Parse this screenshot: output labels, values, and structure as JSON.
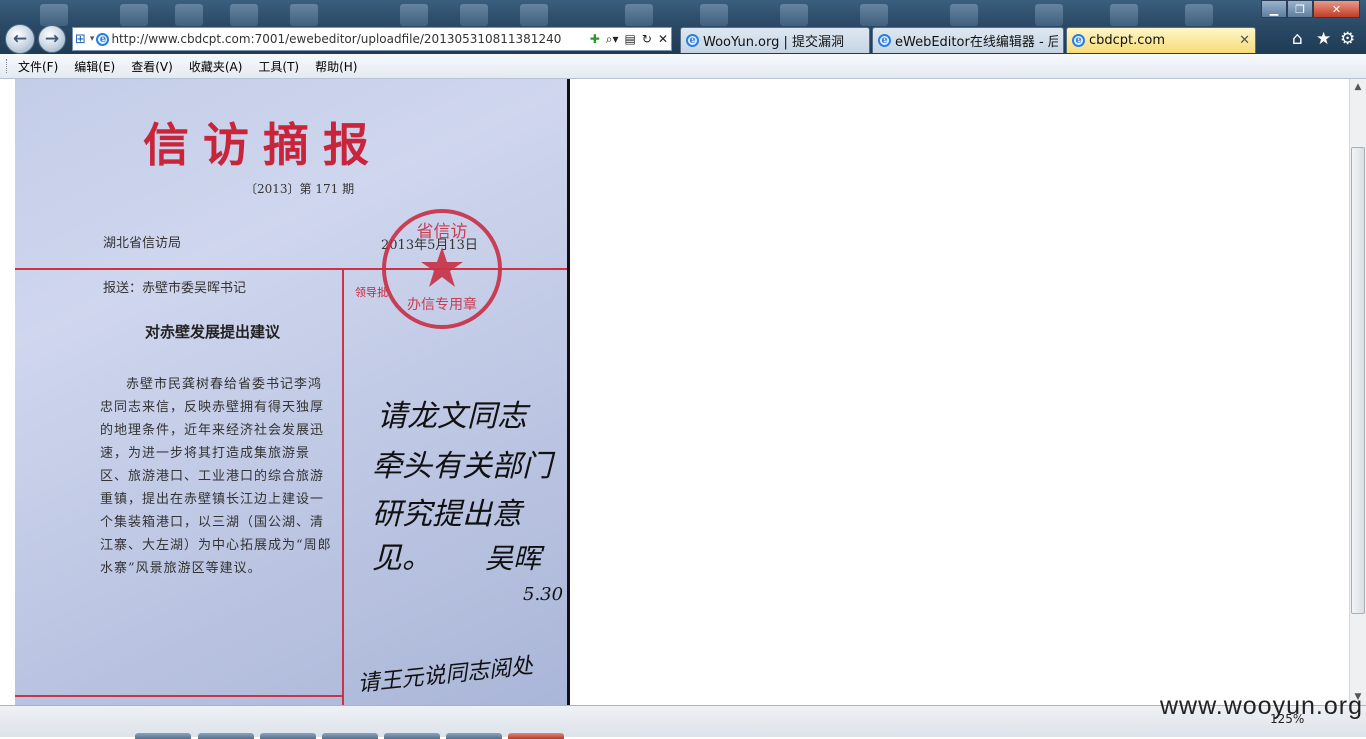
{
  "browser": {
    "address_url": "http://www.cbdcpt.com:7001/ewebeditor/uploadfile/201305310811381240",
    "tabs": [
      {
        "label": "WooYun.org | 提交漏洞",
        "active": false
      },
      {
        "label": "eWebEditor在线编辑器 - 后...",
        "active": false
      },
      {
        "label": "cbdcpt.com",
        "active": true
      }
    ],
    "menu": [
      "文件(F)",
      "编辑(E)",
      "查看(V)",
      "收藏夹(A)",
      "工具(T)",
      "帮助(H)"
    ],
    "zoom": "125%"
  },
  "document": {
    "heading": "信访摘报",
    "issue": "〔2013〕第 171 期",
    "org": "湖北省信访局",
    "date": "2013年5月13日",
    "send_to": "报送：赤壁市委吴晖书记",
    "leader_label": "领导批",
    "subject": "对赤壁发展提出建议",
    "body": "赤壁市民龚树春给省委书记李鸿忠同志来信，反映赤壁拥有得天独厚的地理条件，近年来经济社会发展迅速，为进一步将其打造成集旅游景区、旅游港口、工业港口的综合旅游重镇，提出在赤壁镇长江边上建设一个集装箱港口，以三湖（国公湖、清江寨、大左湖）为中心拓展成为“周郎水寨”风景旅游区等建议。",
    "seal_text": "湖北省信访局办信专用章",
    "handwriting": [
      "请龙文同志",
      "牵头有关部门",
      "研究提出意见。",
      "吴晖",
      "5.30",
      "请王元说同志阅处"
    ]
  },
  "watermark": "www.wooyun.org",
  "colors": {
    "seal_red": "#c8243a",
    "paper": "#c4cde8",
    "active_tab": "#f5dd77"
  }
}
